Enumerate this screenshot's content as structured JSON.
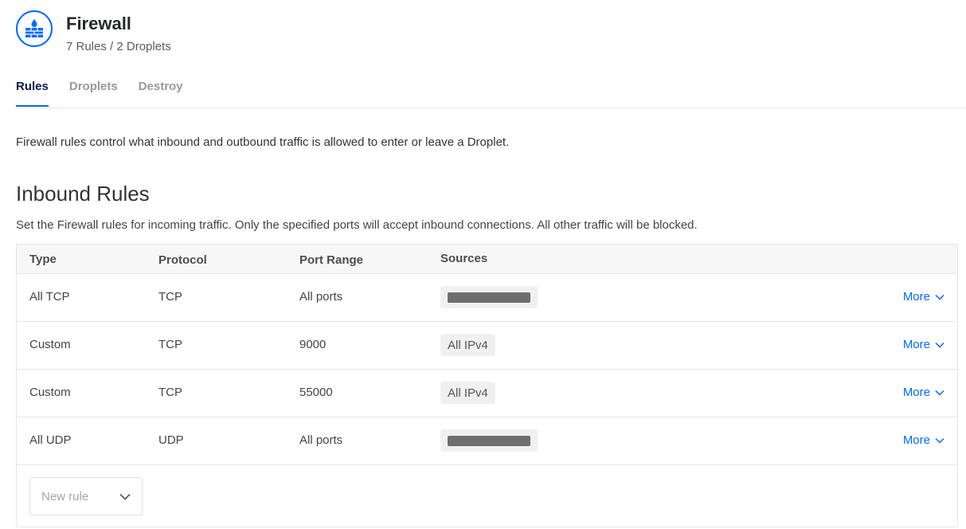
{
  "header": {
    "icon": "firewall-brick-droplet-icon",
    "title": "Firewall",
    "subtitle": "7 Rules / 2 Droplets"
  },
  "tabs": [
    {
      "label": "Rules",
      "active": true
    },
    {
      "label": "Droplets",
      "active": false
    },
    {
      "label": "Destroy",
      "active": false
    }
  ],
  "intro": "Firewall rules control what inbound and outbound traffic is allowed to enter or leave a Droplet.",
  "inbound": {
    "title": "Inbound Rules",
    "description": "Set the Firewall rules for incoming traffic. Only the specified ports will accept inbound connections. All other traffic will be blocked.",
    "columns": [
      "Type",
      "Protocol",
      "Port Range",
      "Sources"
    ],
    "rows": [
      {
        "type": "All TCP",
        "protocol": "TCP",
        "port_range": "All ports",
        "source": "",
        "source_redacted": true,
        "more": "More"
      },
      {
        "type": "Custom",
        "protocol": "TCP",
        "port_range": "9000",
        "source": "All IPv4",
        "source_redacted": false,
        "more": "More"
      },
      {
        "type": "Custom",
        "protocol": "TCP",
        "port_range": "55000",
        "source": "All IPv4",
        "source_redacted": false,
        "more": "More"
      },
      {
        "type": "All UDP",
        "protocol": "UDP",
        "port_range": "All ports",
        "source": "",
        "source_redacted": true,
        "more": "More"
      }
    ],
    "new_rule_placeholder": "New rule"
  },
  "colors": {
    "accent": "#0069ff",
    "active_tab": "#031b4e",
    "redaction": "#6e6e6e"
  }
}
